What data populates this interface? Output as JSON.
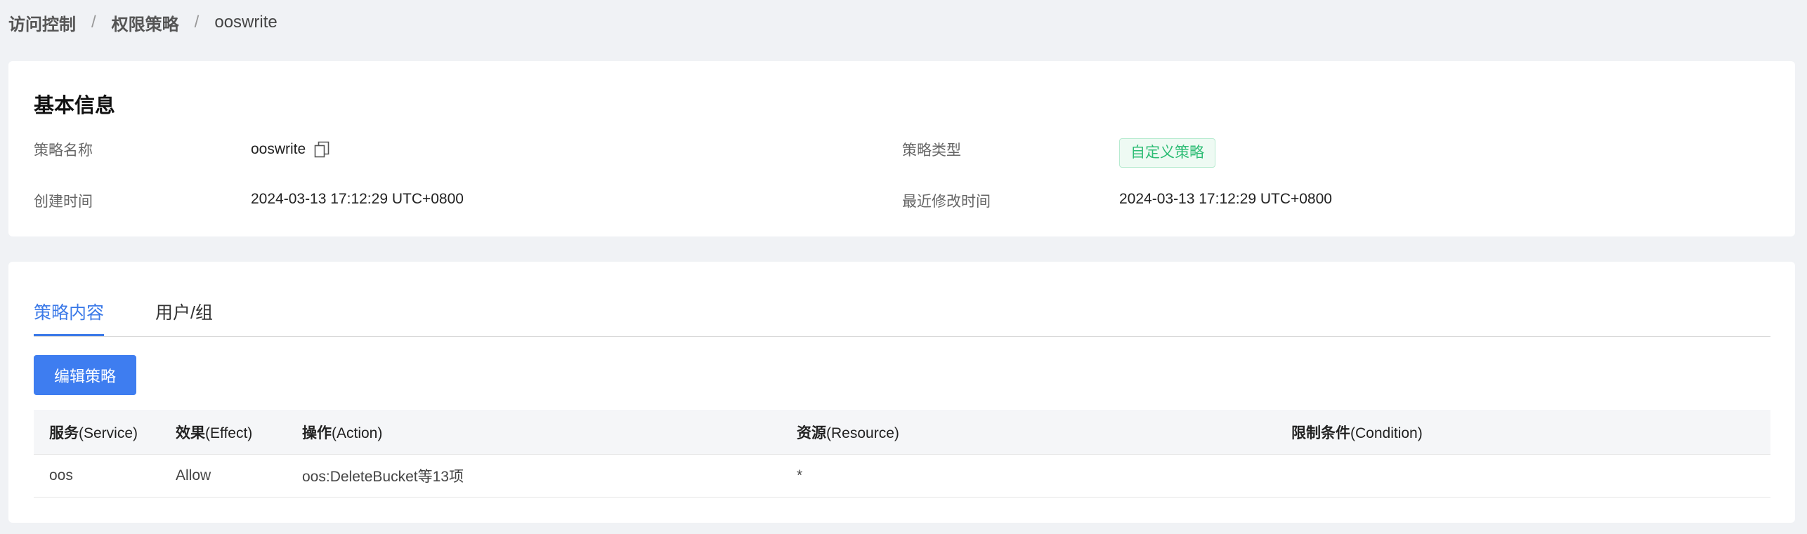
{
  "breadcrumb": {
    "items": [
      "访问控制",
      "权限策略"
    ],
    "separator": "/",
    "current": "ooswrite"
  },
  "basic_info": {
    "title": "基本信息",
    "policy_name_label": "策略名称",
    "policy_name": "ooswrite",
    "policy_type_label": "策略类型",
    "policy_type": "自定义策略",
    "created_label": "创建时间",
    "created": "2024-03-13 17:12:29 UTC+0800",
    "modified_label": "最近修改时间",
    "modified": "2024-03-13 17:12:29 UTC+0800"
  },
  "tabs": [
    {
      "label": "策略内容",
      "active": true
    },
    {
      "label": "用户/组",
      "active": false
    }
  ],
  "edit_button": "编辑策略",
  "table": {
    "columns": [
      {
        "bold": "服务",
        "rest": "(Service)"
      },
      {
        "bold": "效果",
        "rest": "(Effect)"
      },
      {
        "bold": "操作",
        "rest": "(Action)"
      },
      {
        "bold": "资源",
        "rest": "(Resource)"
      },
      {
        "bold": "限制条件",
        "rest": "(Condition)"
      }
    ],
    "rows": [
      [
        "oos",
        "Allow",
        "oos:DeleteBucket等13项",
        "*",
        ""
      ]
    ]
  },
  "colors": {
    "primary": "#3e7df0",
    "tag_green": "#2ebd75",
    "page_background": "#f0f2f5"
  },
  "icons": {
    "copy": "copy-icon"
  }
}
